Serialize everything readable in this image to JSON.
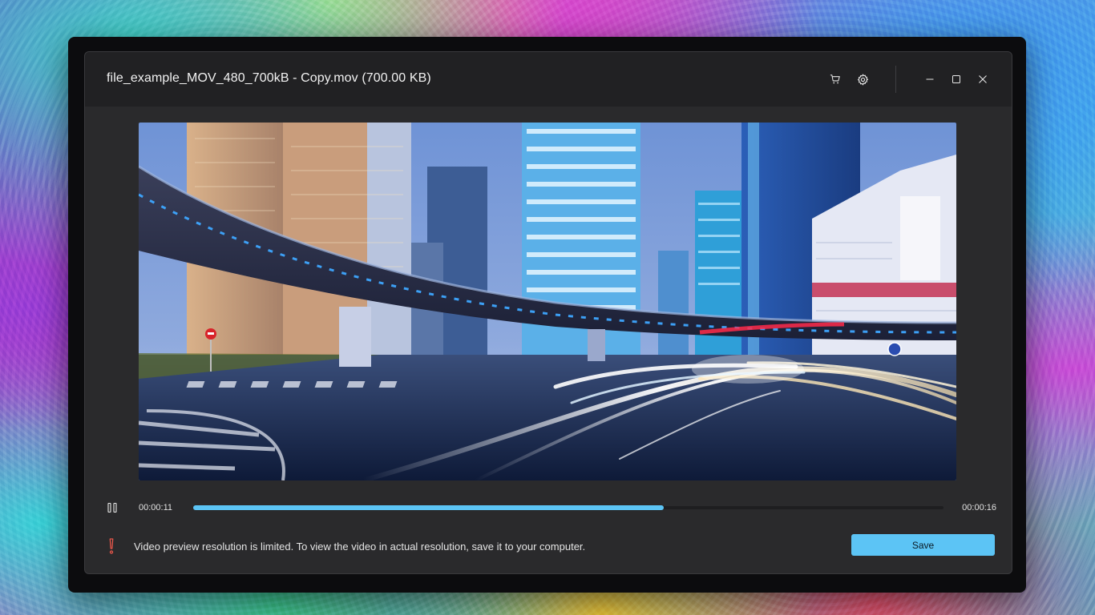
{
  "window": {
    "title": "file_example_MOV_480_700kB - Copy.mov (700.00 KB)"
  },
  "titlebar_icons": [
    "cart-icon",
    "gear-icon",
    "minimize-icon",
    "maximize-icon",
    "close-icon"
  ],
  "player": {
    "current_time": "00:00:11",
    "total_time": "00:00:16",
    "progress_fraction": 0.627,
    "state": "playing"
  },
  "notice": {
    "text": "Video preview resolution is limited. To view the video in actual resolution, save it to your computer.",
    "icon": "exclamation-icon"
  },
  "actions": {
    "save_label": "Save"
  },
  "colors": {
    "accent": "#5cc4f5",
    "warning": "#e8564a",
    "window_bg": "#2a2a2c",
    "titlebar_bg": "#212123"
  }
}
